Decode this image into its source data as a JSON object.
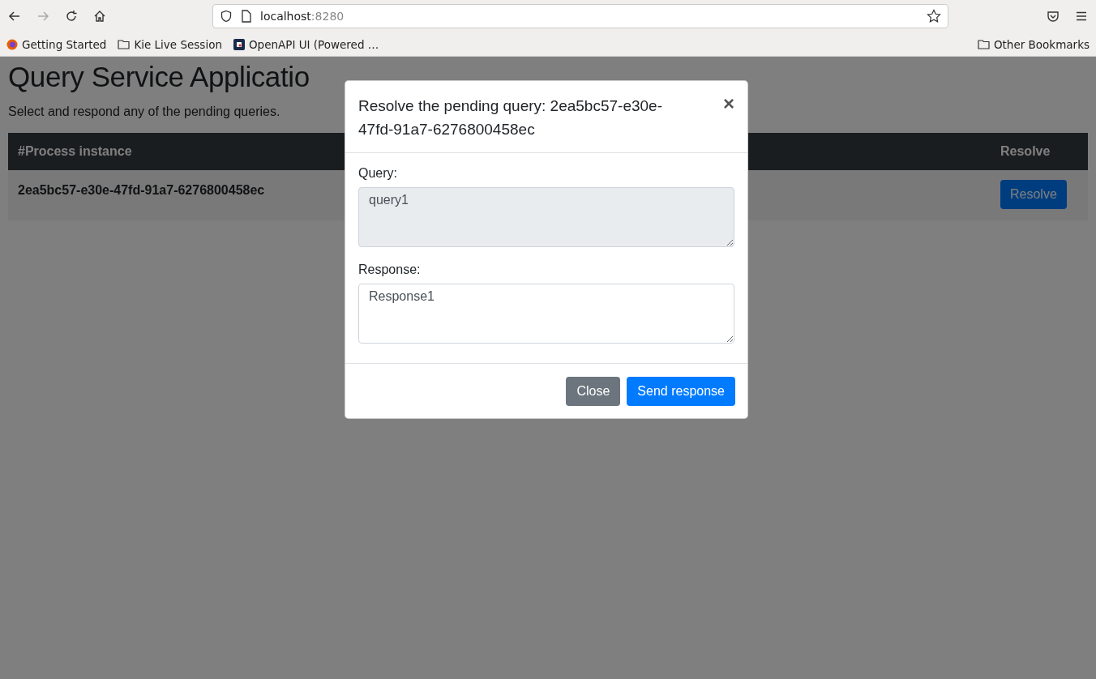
{
  "browser": {
    "url_host": "localhost",
    "url_port": ":8280",
    "bookmarks": [
      {
        "label": "Getting Started",
        "kind": "firefox"
      },
      {
        "label": "Kie Live Session",
        "kind": "folder"
      },
      {
        "label": "OpenAPI UI (Powered …",
        "kind": "app"
      }
    ],
    "other_bookmarks": "Other Bookmarks"
  },
  "page": {
    "title": "Query Service Applicatio",
    "subtitle": "Select and respond any of the pending queries.",
    "table": {
      "columns": [
        "#Process instance",
        "Resolve"
      ],
      "rows": [
        {
          "process_instance": "2ea5bc57-e30e-47fd-91a7-6276800458ec",
          "action": "Resolve"
        }
      ]
    }
  },
  "modal": {
    "title": "Resolve the pending query: 2ea5bc57-e30e-47fd-91a7-6276800458ec",
    "close": "×",
    "fields": [
      {
        "label": "Query:",
        "value": "query1",
        "readonly": true
      },
      {
        "label": "Response:",
        "value": "Response1",
        "readonly": false
      }
    ],
    "buttons": [
      {
        "label": "Close",
        "kind": "secondary"
      },
      {
        "label": "Send response",
        "kind": "primary"
      }
    ]
  }
}
